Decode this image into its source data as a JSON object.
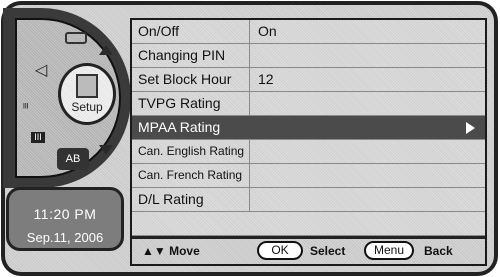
{
  "setup_label": "Setup",
  "dial": {
    "ab_label": "AB"
  },
  "clock": {
    "time": "11:20 PM",
    "date": "Sep.11, 2006"
  },
  "menu": [
    {
      "label": "On/Off",
      "value": "On"
    },
    {
      "label": "Changing PIN",
      "value": ""
    },
    {
      "label": "Set Block Hour",
      "value": "12"
    },
    {
      "label": "TVPG Rating",
      "value": ""
    },
    {
      "label": "MPAA Rating",
      "value": ""
    },
    {
      "label": "Can. English Rating",
      "value": ""
    },
    {
      "label": "Can. French Rating",
      "value": ""
    },
    {
      "label": "D/L Rating",
      "value": ""
    }
  ],
  "footer": {
    "move_label": "▲▼ Move",
    "ok_key": "OK",
    "select_label": "Select",
    "menu_key": "Menu",
    "back_label": "Back"
  },
  "colors": {
    "selected_row": "#4b4b4b",
    "frame": "#222222"
  }
}
